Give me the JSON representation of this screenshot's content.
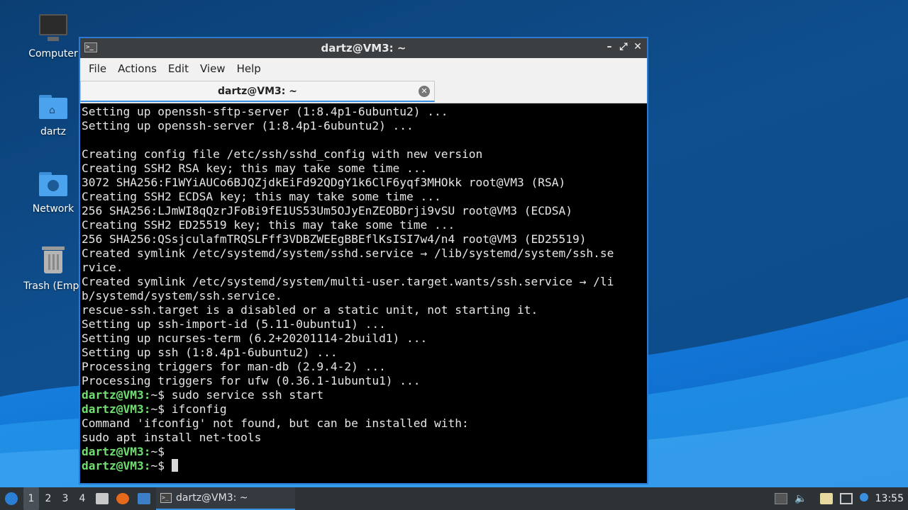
{
  "desktop": {
    "icons": [
      {
        "label": "Computer",
        "icon": "computer-icon"
      },
      {
        "label": "dartz",
        "icon": "home-folder-icon"
      },
      {
        "label": "Network",
        "icon": "network-folder-icon"
      },
      {
        "label": "Trash (Empt",
        "icon": "trash-icon"
      }
    ]
  },
  "window": {
    "title": "dartz@VM3: ~",
    "controls": {
      "minimize": "–",
      "maximize": "⤢",
      "close": "✕"
    },
    "menu": [
      "File",
      "Actions",
      "Edit",
      "View",
      "Help"
    ],
    "tab": {
      "label": "dartz@VM3: ~",
      "close": "✕"
    }
  },
  "terminal": {
    "prompt": "dartz@VM3:",
    "lines": [
      {
        "text": "Setting up openssh-sftp-server (1:8.4p1-6ubuntu2) ..."
      },
      {
        "text": "Setting up openssh-server (1:8.4p1-6ubuntu2) ..."
      },
      {
        "text": ""
      },
      {
        "text": "Creating config file /etc/ssh/sshd_config with new version"
      },
      {
        "text": "Creating SSH2 RSA key; this may take some time ..."
      },
      {
        "text": "3072 SHA256:F1WYiAUCo6BJQZjdkEiFd92QDgY1k6ClF6yqf3MHOkk root@VM3 (RSA)"
      },
      {
        "text": "Creating SSH2 ECDSA key; this may take some time ..."
      },
      {
        "text": "256 SHA256:LJmWI8qQzrJFoBi9fE1US53Um5OJyEnZEOBDrji9vSU root@VM3 (ECDSA)"
      },
      {
        "text": "Creating SSH2 ED25519 key; this may take some time ..."
      },
      {
        "text": "256 SHA256:QSsjculafmTRQSLFff3VDBZWEEgBBEflKsISI7w4/n4 root@VM3 (ED25519)"
      },
      {
        "text": "Created symlink /etc/systemd/system/sshd.service → /lib/systemd/system/ssh.se"
      },
      {
        "text": "rvice."
      },
      {
        "text": "Created symlink /etc/systemd/system/multi-user.target.wants/ssh.service → /li"
      },
      {
        "text": "b/systemd/system/ssh.service."
      },
      {
        "text": "rescue-ssh.target is a disabled or a static unit, not starting it."
      },
      {
        "text": "Setting up ssh-import-id (5.11-0ubuntu1) ..."
      },
      {
        "text": "Setting up ncurses-term (6.2+20201114-2build1) ..."
      },
      {
        "text": "Setting up ssh (1:8.4p1-6ubuntu2) ..."
      },
      {
        "text": "Processing triggers for man-db (2.9.4-2) ..."
      },
      {
        "text": "Processing triggers for ufw (0.36.1-1ubuntu1) ..."
      },
      {
        "prompt": true,
        "text": "~$ sudo service ssh start"
      },
      {
        "prompt": true,
        "text": "~$ ifconfig"
      },
      {
        "text": "Command 'ifconfig' not found, but can be installed with:"
      },
      {
        "text": "sudo apt install net-tools"
      },
      {
        "prompt": true,
        "text": "~$ "
      },
      {
        "prompt": true,
        "text": "~$ ",
        "cursor": true
      }
    ]
  },
  "taskbar": {
    "workspaces": [
      "1",
      "2",
      "3",
      "4"
    ],
    "active_workspace": "1",
    "task_label": "dartz@VM3: ~",
    "clock": "13:55",
    "launchers": [
      "file-manager-icon",
      "firefox-icon",
      "desktop-icon"
    ],
    "tray": [
      "updates-icon",
      "volume-icon",
      "clipboard-icon",
      "network-icon",
      "notification-icon"
    ]
  }
}
